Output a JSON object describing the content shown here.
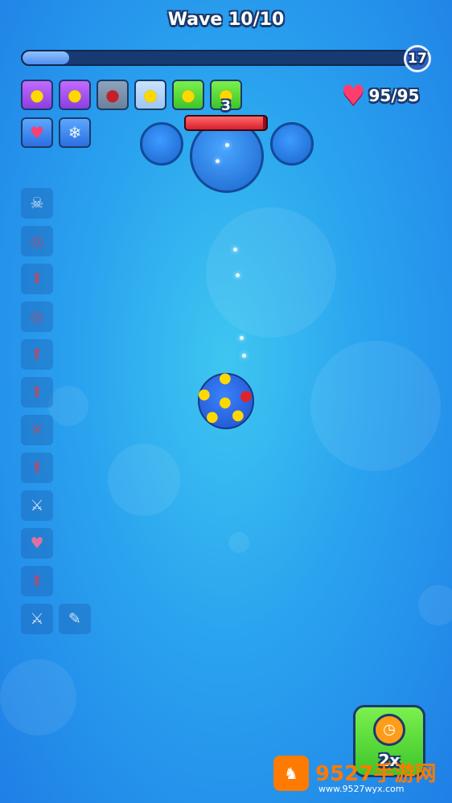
{
  "hud": {
    "wave_label": "Wave 10/10",
    "wave_progress": 0.12,
    "level": "17",
    "hp_text": "95/95"
  },
  "inventory": {
    "row1": [
      {
        "icon": "chick-icon",
        "color": "purple"
      },
      {
        "icon": "chick-icon",
        "color": "purple"
      },
      {
        "icon": "bomb-icon",
        "color": "grey"
      },
      {
        "icon": "chick-icon",
        "color": "lightblue"
      },
      {
        "icon": "chick-icon",
        "color": "green"
      },
      {
        "icon": "chick-icon",
        "color": "green"
      }
    ],
    "row2": [
      {
        "icon": "heart-target-icon",
        "color": "blue"
      },
      {
        "icon": "snowflake-icon",
        "color": "blue"
      }
    ]
  },
  "skills": [
    "skull-icon",
    "chain-target-icon",
    "bomb-upgrade-icon",
    "bomb-target-icon",
    "bomb-upgrade-icon",
    "bomb-upgrade-icon",
    "explosion-cancel-icon",
    "explosion-double-icon",
    "sword-double-icon",
    "heart-upgrade-icon",
    "bomb-upgrade-icon",
    "sword-icon",
    "syringe-icon"
  ],
  "boss": {
    "hp_label": "3"
  },
  "speed_button": {
    "label": "2x"
  },
  "watermark": {
    "text": "9527手游网",
    "url": "www.9527wyx.com"
  },
  "colors": {
    "accent_green": "#3cc52a",
    "heart": "#ff3d6e",
    "boss_hp": "#d81f2c"
  }
}
